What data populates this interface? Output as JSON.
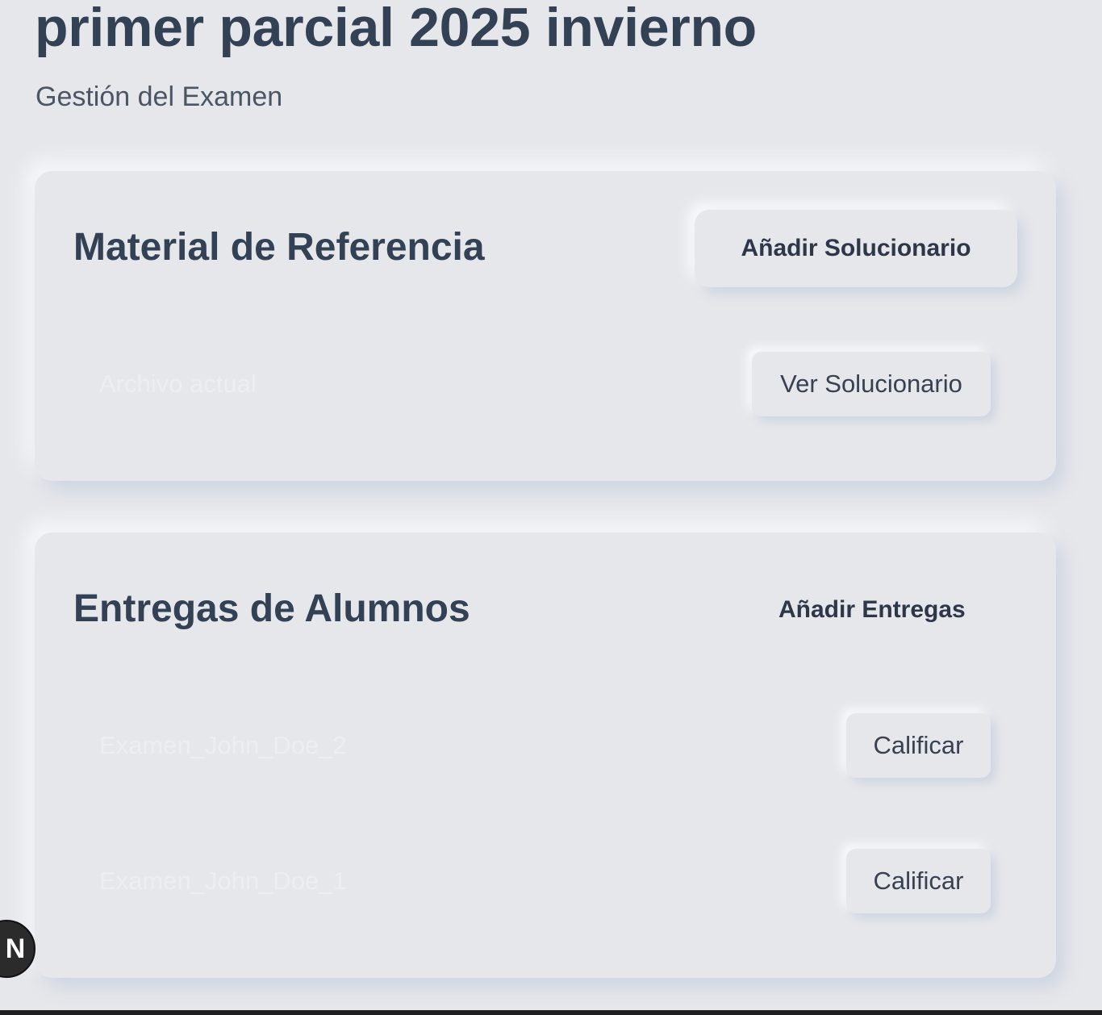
{
  "header": {
    "title": "primer parcial 2025 invierno",
    "subtitle": "Gestión del Examen"
  },
  "reference": {
    "title": "Material de Referencia",
    "add_label": "Añadir Solucionario",
    "file_label": "Archivo actual",
    "view_label": "Ver Solucionario"
  },
  "submissions": {
    "title": "Entregas de Alumnos",
    "add_label": "Añadir Entregas",
    "items": [
      {
        "name": "Examen_John_Doe_2",
        "action": "Calificar"
      },
      {
        "name": "Examen_John_Doe_1",
        "action": "Calificar"
      }
    ]
  },
  "dev_badge": {
    "letter": "N"
  },
  "colors": {
    "background": "#e6e7eb",
    "text": "#334155",
    "faint_text": "#eceef1"
  }
}
